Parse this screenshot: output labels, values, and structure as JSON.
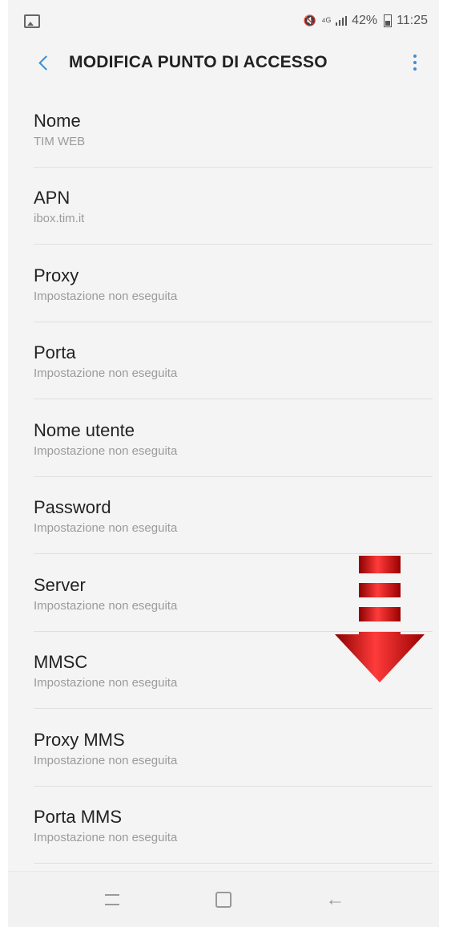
{
  "status": {
    "battery": "42%",
    "time": "11:25"
  },
  "appbar": {
    "title": "MODIFICA PUNTO DI ACCESSO"
  },
  "fields": [
    {
      "label": "Nome",
      "value": "TIM WEB"
    },
    {
      "label": "APN",
      "value": "ibox.tim.it"
    },
    {
      "label": "Proxy",
      "value": "Impostazione non eseguita"
    },
    {
      "label": "Porta",
      "value": "Impostazione non eseguita"
    },
    {
      "label": "Nome utente",
      "value": "Impostazione non eseguita"
    },
    {
      "label": "Password",
      "value": "Impostazione non eseguita"
    },
    {
      "label": "Server",
      "value": "Impostazione non eseguita"
    },
    {
      "label": "MMSC",
      "value": "Impostazione non eseguita"
    },
    {
      "label": "Proxy MMS",
      "value": "Impostazione non eseguita"
    },
    {
      "label": "Porta MMS",
      "value": "Impostazione non eseguita"
    }
  ],
  "colors": {
    "accent": "#3a8ed8",
    "arrow": "#cc1010"
  }
}
